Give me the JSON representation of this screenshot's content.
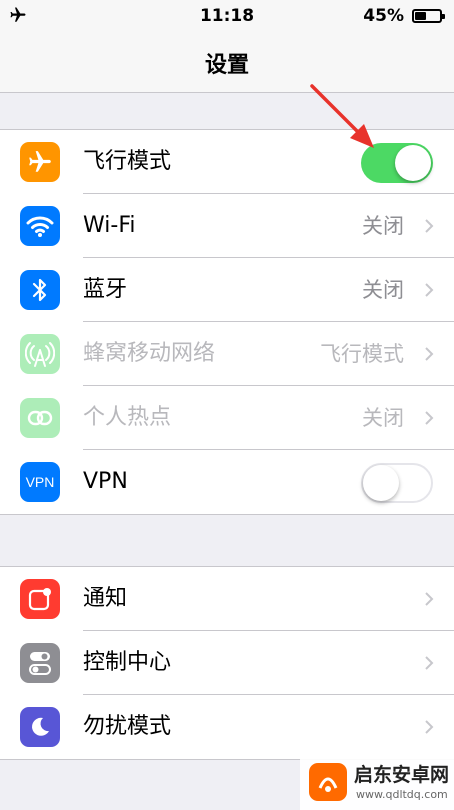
{
  "status_bar": {
    "time": "11:18",
    "battery": "45%",
    "battery_level": 0.45
  },
  "nav": {
    "title": "设置"
  },
  "network_group": [
    {
      "label": "飞行模式",
      "icon": "airplane-icon",
      "color": "#ff9500",
      "toggle": true
    },
    {
      "label": "Wi-Fi",
      "value": "关闭",
      "icon": "wifi-icon",
      "color": "#007aff"
    },
    {
      "label": "蓝牙",
      "value": "关闭",
      "icon": "bluetooth-icon",
      "color": "#007aff"
    },
    {
      "label": "蜂窝移动网络",
      "value": "飞行模式",
      "icon": "cellular-icon",
      "color": "#4cd964",
      "disabled": true
    },
    {
      "label": "个人热点",
      "value": "关闭",
      "icon": "hotspot-icon",
      "color": "#4cd964",
      "disabled": true
    },
    {
      "label": "VPN",
      "icon": "vpn-icon",
      "icon_text": "VPN",
      "color": "#007aff",
      "toggle": false
    }
  ],
  "system_group": [
    {
      "label": "通知",
      "icon": "notification-icon",
      "color": "#ff3b30"
    },
    {
      "label": "控制中心",
      "icon": "control-center-icon",
      "color": "#8e8e93"
    },
    {
      "label": "勿扰模式",
      "icon": "moon-icon",
      "color": "#5856d6"
    }
  ],
  "watermark": {
    "title": "启东安卓网",
    "url": "www.qdltdq.com"
  }
}
